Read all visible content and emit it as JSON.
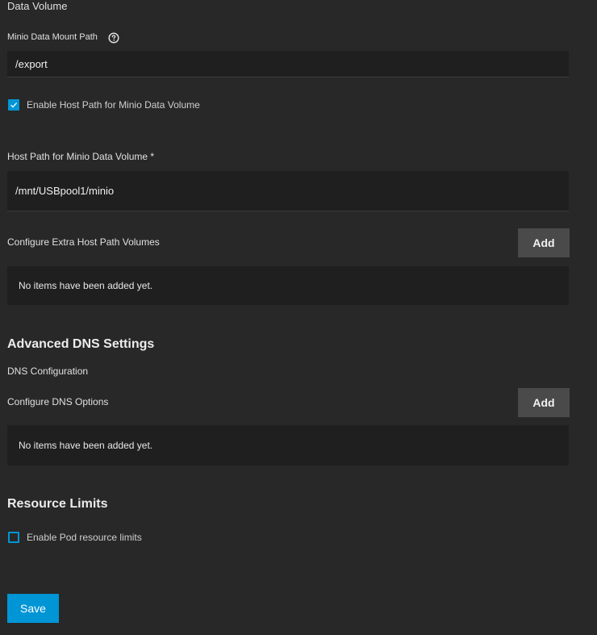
{
  "data_volume": {
    "section_title": "Data Volume",
    "mount_path_label": "Minio Data Mount Path",
    "mount_path_value": "/export",
    "host_path_checkbox_label": "Enable Host Path for Minio Data Volume",
    "host_path_checkbox_checked": true,
    "host_path_label": "Host Path for Minio Data Volume *",
    "host_path_value": "/mnt/USBpool1/minio",
    "extra_volumes_label": "Configure Extra Host Path Volumes",
    "extra_volumes_add_label": "Add",
    "extra_volumes_empty": "No items have been added yet."
  },
  "dns": {
    "heading": "Advanced DNS Settings",
    "config_label": "DNS Configuration",
    "options_label": "Configure DNS Options",
    "options_add_label": "Add",
    "options_empty": "No items have been added yet."
  },
  "resources": {
    "heading": "Resource Limits",
    "pod_limits_label": "Enable Pod resource limits",
    "pod_limits_checked": false
  },
  "actions": {
    "save_label": "Save"
  },
  "colors": {
    "background": "#282828",
    "field_background": "#1f1f1f",
    "accent": "#0095d5",
    "button_grey": "#4a4a4a"
  },
  "icons": {
    "help": "help-circle-icon",
    "check": "checkmark-icon"
  }
}
